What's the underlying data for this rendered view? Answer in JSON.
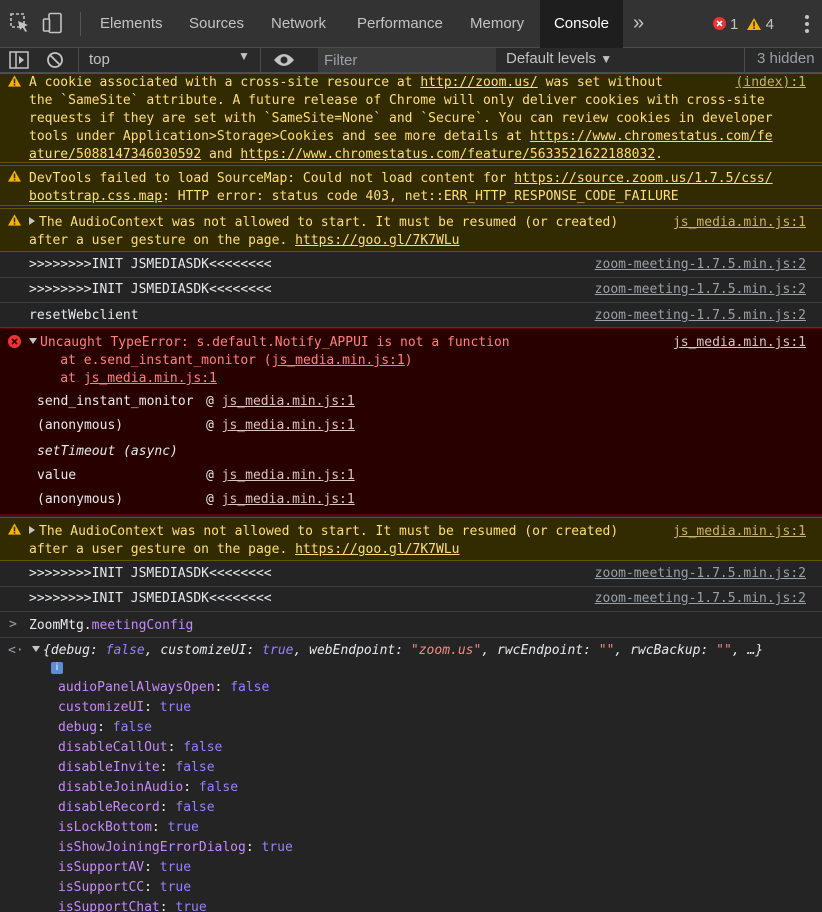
{
  "tabs": [
    {
      "label": "Elements",
      "active": false
    },
    {
      "label": "Sources",
      "active": false
    },
    {
      "label": "Network",
      "active": false
    },
    {
      "label": "Performance",
      "active": false
    },
    {
      "label": "Memory",
      "active": false
    },
    {
      "label": "Console",
      "active": true
    }
  ],
  "more_tabs_glyph": "»",
  "error_count": "1",
  "warning_count": "4",
  "toolbar": {
    "context": "top",
    "filter_placeholder": "Filter",
    "levels": "Default levels",
    "hidden": "3 hidden"
  },
  "messages": {
    "cookie": {
      "lines": [
        "A cookie associated with a cross-site resource at ",
        "http://zoom.us/",
        " was set without",
        "the `SameSite` attribute. A future release of Chrome will only deliver cookies with cross-site",
        "requests if they are set with `SameSite=None` and `Secure`. You can review cookies in developer",
        "tools under Application>Storage>Cookies and see more details at ",
        "https://www.chromestatus.com/fe",
        "ature/5088147346030592",
        " and ",
        "https://www.chromestatus.com/feature/5633521622188032",
        "."
      ],
      "source": "(index):1"
    },
    "sourcemap": {
      "line1": "DevTools failed to load SourceMap: Could not load content for ",
      "link1": "https://source.zoom.us/1.7.5/css/",
      "link2": "bootstrap.css.map",
      "line2": ": HTTP error: status code 403, net::ERR_HTTP_RESPONSE_CODE_FAILURE"
    },
    "audio1": {
      "line1": "The AudioContext was not allowed to start. It must be resumed (or created)",
      "line2": "after a user gesture on the page. ",
      "link": "https://goo.gl/7K7WLu",
      "source": "js_media.min.js:1"
    },
    "init1": {
      "text": ">>>>>>>>INIT JSMEDIASDK<<<<<<<<",
      "source": "zoom-meeting-1.7.5.min.js:2"
    },
    "init2": {
      "text": ">>>>>>>>INIT JSMEDIASDK<<<<<<<<",
      "source": "zoom-meeting-1.7.5.min.js:2"
    },
    "reset": {
      "text": "resetWebclient",
      "source": "zoom-meeting-1.7.5.min.js:2"
    },
    "error": {
      "line1": "Uncaught TypeError: s.default.Notify_APPUI is not a function",
      "line2a": "    at e.send_instant_monitor (",
      "line2link": "js_media.min.js:1",
      "line2b": ")",
      "line3a": "    at ",
      "line3link": "js_media.min.js:1",
      "source": "js_media.min.js:1",
      "stack": [
        {
          "fn": "send_instant_monitor",
          "at": "@ ",
          "loc": "js_media.min.js:1"
        },
        {
          "fn": "(anonymous)",
          "at": "@ ",
          "loc": "js_media.min.js:1"
        },
        {
          "fn": "setTimeout (async)",
          "at": "",
          "loc": ""
        },
        {
          "fn": "value",
          "at": "@ ",
          "loc": "js_media.min.js:1"
        },
        {
          "fn": "(anonymous)",
          "at": "@ ",
          "loc": "js_media.min.js:1"
        }
      ]
    },
    "audio2": {
      "line1": "The AudioContext was not allowed to start. It must be resumed (or created)",
      "line2": "after a user gesture on the page. ",
      "link": "https://goo.gl/7K7WLu",
      "source": "js_media.min.js:1"
    },
    "init3": {
      "text": ">>>>>>>>INIT JSMEDIASDK<<<<<<<<",
      "source": "zoom-meeting-1.7.5.min.js:2"
    },
    "init4": {
      "text": ">>>>>>>>INIT JSMEDIASDK<<<<<<<<",
      "source": "zoom-meeting-1.7.5.min.js:2"
    }
  },
  "input": {
    "obj": "ZoomMtg",
    "prop": "meetingConfig"
  },
  "result": {
    "preview": [
      {
        "k": "debug",
        "v": "false",
        "t": "bool"
      },
      {
        "k": "customizeUI",
        "v": "true",
        "t": "bool"
      },
      {
        "k": "webEndpoint",
        "v": "\"zoom.us\"",
        "t": "str"
      },
      {
        "k": "rwcEndpoint",
        "v": "\"\"",
        "t": "str"
      },
      {
        "k": "rwcBackup",
        "v": "\"\"",
        "t": "str"
      }
    ],
    "info_badge": "i",
    "props": [
      {
        "k": "audioPanelAlwaysOpen",
        "v": "false"
      },
      {
        "k": "customizeUI",
        "v": "true"
      },
      {
        "k": "debug",
        "v": "false"
      },
      {
        "k": "disableCallOut",
        "v": "false"
      },
      {
        "k": "disableInvite",
        "v": "false"
      },
      {
        "k": "disableJoinAudio",
        "v": "false"
      },
      {
        "k": "disableRecord",
        "v": "false"
      },
      {
        "k": "isLockBottom",
        "v": "true"
      },
      {
        "k": "isShowJoiningErrorDialog",
        "v": "true"
      },
      {
        "k": "isSupportAV",
        "v": "true"
      },
      {
        "k": "isSupportCC",
        "v": "true"
      },
      {
        "k": "isSupportChat",
        "v": "true"
      }
    ]
  }
}
